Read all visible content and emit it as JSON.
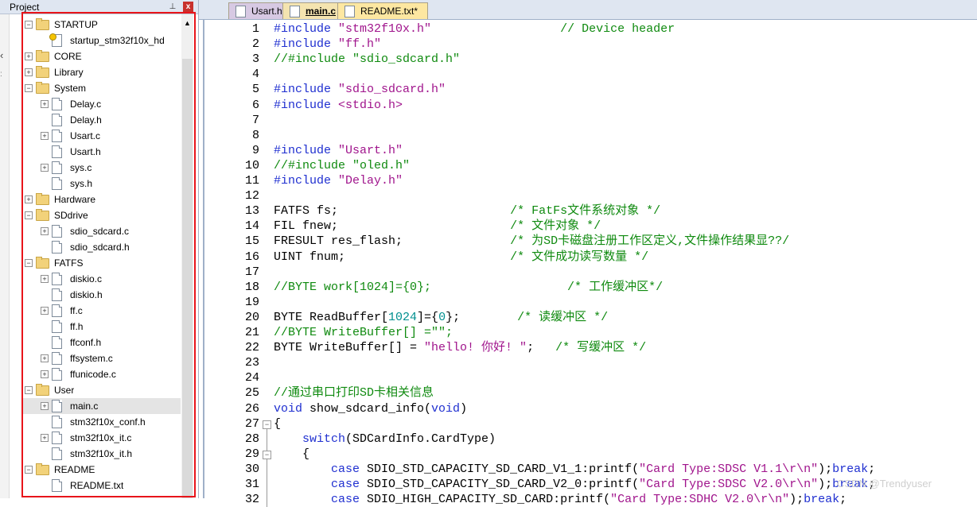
{
  "project_pane": {
    "title": "Project",
    "pin_glyph": "⊥",
    "close_glyph": "x",
    "tree": [
      {
        "label": "STARTUP",
        "kind": "folder",
        "expanded": true,
        "depth": 0
      },
      {
        "label": "startup_stm32f10x_hd",
        "kind": "startup-file",
        "depth": 1
      },
      {
        "label": "CORE",
        "kind": "folder",
        "expanded": false,
        "depth": 0
      },
      {
        "label": "Library",
        "kind": "folder",
        "expanded": false,
        "depth": 0
      },
      {
        "label": "System",
        "kind": "folder",
        "expanded": true,
        "depth": 0
      },
      {
        "label": "Delay.c",
        "kind": "file",
        "expandable": true,
        "depth": 1
      },
      {
        "label": "Delay.h",
        "kind": "file",
        "expandable": false,
        "depth": 1
      },
      {
        "label": "Usart.c",
        "kind": "file",
        "expandable": true,
        "depth": 1
      },
      {
        "label": "Usart.h",
        "kind": "file",
        "expandable": false,
        "depth": 1
      },
      {
        "label": "sys.c",
        "kind": "file",
        "expandable": true,
        "depth": 1
      },
      {
        "label": "sys.h",
        "kind": "file",
        "expandable": false,
        "depth": 1
      },
      {
        "label": "Hardware",
        "kind": "folder",
        "expanded": false,
        "depth": 0
      },
      {
        "label": "SDdrive",
        "kind": "folder",
        "expanded": true,
        "depth": 0
      },
      {
        "label": "sdio_sdcard.c",
        "kind": "file",
        "expandable": true,
        "depth": 1
      },
      {
        "label": "sdio_sdcard.h",
        "kind": "file",
        "expandable": false,
        "depth": 1
      },
      {
        "label": "FATFS",
        "kind": "folder",
        "expanded": true,
        "depth": 0
      },
      {
        "label": "diskio.c",
        "kind": "file",
        "expandable": true,
        "depth": 1
      },
      {
        "label": "diskio.h",
        "kind": "file",
        "expandable": false,
        "depth": 1
      },
      {
        "label": "ff.c",
        "kind": "file",
        "expandable": true,
        "depth": 1
      },
      {
        "label": "ff.h",
        "kind": "file",
        "expandable": false,
        "depth": 1
      },
      {
        "label": "ffconf.h",
        "kind": "file",
        "expandable": false,
        "depth": 1
      },
      {
        "label": "ffsystem.c",
        "kind": "file",
        "expandable": true,
        "depth": 1
      },
      {
        "label": "ffunicode.c",
        "kind": "file",
        "expandable": true,
        "depth": 1
      },
      {
        "label": "User",
        "kind": "folder",
        "expanded": true,
        "depth": 0
      },
      {
        "label": "main.c",
        "kind": "file",
        "expandable": true,
        "depth": 1,
        "selected": true
      },
      {
        "label": "stm32f10x_conf.h",
        "kind": "file",
        "expandable": false,
        "depth": 1
      },
      {
        "label": "stm32f10x_it.c",
        "kind": "file",
        "expandable": true,
        "depth": 1
      },
      {
        "label": "stm32f10x_it.h",
        "kind": "file",
        "expandable": false,
        "depth": 1
      },
      {
        "label": "README",
        "kind": "folder",
        "expanded": true,
        "depth": 0
      },
      {
        "label": "README.txt",
        "kind": "file",
        "expandable": false,
        "depth": 1
      }
    ]
  },
  "tabs": [
    {
      "label": "Usart.h",
      "active": false
    },
    {
      "label": "main.c",
      "active": true
    },
    {
      "label": "README.txt*",
      "active": false
    }
  ],
  "editor": {
    "fold_markers": [
      {
        "line": 27,
        "glyph": "−"
      },
      {
        "line": 29,
        "glyph": "−"
      }
    ],
    "lines": [
      {
        "n": "1",
        "tokens": [
          [
            "kw",
            "#include "
          ],
          [
            "str",
            "\"stm32f10x.h\""
          ],
          [
            "",
            "                  "
          ],
          [
            "cmt",
            "// Device header"
          ]
        ]
      },
      {
        "n": "2",
        "tokens": [
          [
            "kw",
            "#include "
          ],
          [
            "str",
            "\"ff.h\""
          ]
        ]
      },
      {
        "n": "3",
        "tokens": [
          [
            "cmt",
            "//#include \"sdio_sdcard.h\""
          ]
        ]
      },
      {
        "n": "4",
        "tokens": []
      },
      {
        "n": "5",
        "tokens": [
          [
            "kw",
            "#include "
          ],
          [
            "str",
            "\"sdio_sdcard.h\""
          ]
        ]
      },
      {
        "n": "6",
        "tokens": [
          [
            "kw",
            "#include "
          ],
          [
            "str",
            "<stdio.h>"
          ]
        ]
      },
      {
        "n": "7",
        "tokens": []
      },
      {
        "n": "8",
        "tokens": []
      },
      {
        "n": "9",
        "tokens": [
          [
            "kw",
            "#include "
          ],
          [
            "str",
            "\"Usart.h\""
          ]
        ]
      },
      {
        "n": "10",
        "tokens": [
          [
            "cmt",
            "//#include \"oled.h\""
          ]
        ]
      },
      {
        "n": "11",
        "tokens": [
          [
            "kw",
            "#include "
          ],
          [
            "str",
            "\"Delay.h\""
          ]
        ]
      },
      {
        "n": "12",
        "tokens": []
      },
      {
        "n": "13",
        "tokens": [
          [
            "",
            "FATFS fs;                        "
          ],
          [
            "cmt",
            "/* FatFs文件系统对象 */"
          ]
        ]
      },
      {
        "n": "14",
        "tokens": [
          [
            "",
            "FIL fnew;                        "
          ],
          [
            "cmt",
            "/* 文件对象 */"
          ]
        ]
      },
      {
        "n": "15",
        "tokens": [
          [
            "",
            "FRESULT res_flash;               "
          ],
          [
            "cmt",
            "/* 为SD卡磁盘注册工作区定义,文件操作结果显??/"
          ]
        ]
      },
      {
        "n": "16",
        "tokens": [
          [
            "",
            "UINT fnum;                       "
          ],
          [
            "cmt",
            "/* 文件成功读写数量 */"
          ]
        ]
      },
      {
        "n": "17",
        "tokens": []
      },
      {
        "n": "18",
        "tokens": [
          [
            "cmt",
            "//BYTE work[1024]={0};                   /* 工作缓冲区*/"
          ]
        ]
      },
      {
        "n": "19",
        "tokens": []
      },
      {
        "n": "20",
        "tokens": [
          [
            "",
            "BYTE ReadBuffer["
          ],
          [
            "num",
            "1024"
          ],
          [
            "",
            "]={"
          ],
          [
            "num",
            "0"
          ],
          [
            "",
            "};        "
          ],
          [
            "cmt",
            "/* 读缓冲区 */"
          ]
        ]
      },
      {
        "n": "21",
        "tokens": [
          [
            "cmt",
            "//BYTE WriteBuffer[] =\"\";"
          ]
        ]
      },
      {
        "n": "22",
        "tokens": [
          [
            "",
            "BYTE WriteBuffer[] = "
          ],
          [
            "str",
            "\"hello! 你好! \""
          ],
          [
            "",
            ";   "
          ],
          [
            "cmt",
            "/* 写缓冲区 */"
          ]
        ]
      },
      {
        "n": "23",
        "tokens": []
      },
      {
        "n": "24",
        "tokens": []
      },
      {
        "n": "25",
        "tokens": [
          [
            "cmt",
            "//通过串口打印SD卡相关信息"
          ]
        ]
      },
      {
        "n": "26",
        "tokens": [
          [
            "kw",
            "void"
          ],
          [
            "",
            " show_sdcard_info("
          ],
          [
            "kw",
            "void"
          ],
          [
            "",
            ")"
          ]
        ]
      },
      {
        "n": "27",
        "tokens": [
          [
            "",
            "{"
          ]
        ]
      },
      {
        "n": "28",
        "tokens": [
          [
            "",
            "    "
          ],
          [
            "kw",
            "switch"
          ],
          [
            "",
            "(SDCardInfo.CardType)"
          ]
        ]
      },
      {
        "n": "29",
        "tokens": [
          [
            "",
            "    {"
          ]
        ]
      },
      {
        "n": "30",
        "tokens": [
          [
            "",
            "        "
          ],
          [
            "kw",
            "case"
          ],
          [
            "",
            " SDIO_STD_CAPACITY_SD_CARD_V1_1:printf("
          ],
          [
            "str",
            "\"Card Type:SDSC V1.1\\r\\n\""
          ],
          [
            "",
            ");"
          ],
          [
            "kw",
            "break"
          ],
          [
            "",
            ";"
          ]
        ]
      },
      {
        "n": "31",
        "tokens": [
          [
            "",
            "        "
          ],
          [
            "kw",
            "case"
          ],
          [
            "",
            " SDIO_STD_CAPACITY_SD_CARD_V2_0:printf("
          ],
          [
            "str",
            "\"Card Type:SDSC V2.0\\r\\n\""
          ],
          [
            "",
            ");"
          ],
          [
            "kw",
            "break"
          ],
          [
            "",
            ";"
          ]
        ]
      },
      {
        "n": "32",
        "tokens": [
          [
            "",
            "        "
          ],
          [
            "kw",
            "case"
          ],
          [
            "",
            " SDIO_HIGH_CAPACITY_SD_CARD:printf("
          ],
          [
            "str",
            "\"Card Type:SDHC V2.0\\r\\n\""
          ],
          [
            "",
            ");"
          ],
          [
            "kw",
            "break"
          ],
          [
            "",
            ";"
          ]
        ]
      }
    ]
  },
  "watermark": "CSDN @Trendyuser",
  "colors": {
    "highlight_box": "#e8141a",
    "keyword": "#1f2fd0",
    "string": "#a0148c",
    "comment": "#0f8a0f",
    "number": "#008f8f"
  }
}
